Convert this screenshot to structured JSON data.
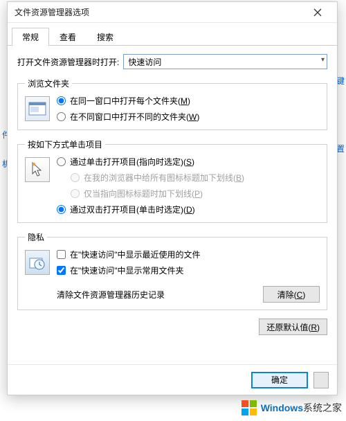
{
  "dialog": {
    "title": "文件资源管理器选项",
    "tabs": [
      "常规",
      "查看",
      "搜索"
    ],
    "active_tab": 0
  },
  "open_row": {
    "label": "打开文件资源管理器时打开:",
    "value": "快速访问"
  },
  "browse": {
    "legend": "浏览文件夹",
    "opt_same": "在同一窗口中打开每个文件夹(",
    "opt_same_key": "M",
    "opt_diff": "在不同窗口中打开不同的文件夹(",
    "opt_diff_key": "W"
  },
  "click": {
    "legend": "按如下方式单击项目",
    "single": "通过单击打开项目(指向时选定)(",
    "single_key": "S",
    "under_all": "在我的浏览器中给所有图标标题加下划线(",
    "under_all_key": "B",
    "under_point": "仅当指向图标标题时加下划线(",
    "under_point_key": "P",
    "double": "通过双击打开项目(单击时选定)(",
    "double_key": "D"
  },
  "privacy": {
    "legend": "隐私",
    "recent": "在\"快速访问\"中显示最近使用的文件",
    "frequent": "在\"快速访问\"中显示常用文件夹",
    "clear_label": "清除文件资源管理器历史记录",
    "clear_btn": "清除(",
    "clear_key": "C"
  },
  "restore": {
    "label": "还原默认值(",
    "key": "R"
  },
  "footer": {
    "ok": "确定"
  },
  "watermark": {
    "brand": "Windows",
    "suffix": "系统之家"
  },
  "behind": {
    "t1": "目键",
    "t2": "件夹",
    "t3": "设置",
    "t4": "机"
  },
  "paren_close": ")"
}
